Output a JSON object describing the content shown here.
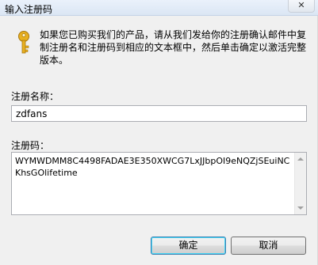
{
  "window": {
    "title": "输入注册码",
    "close_symbol": "✕"
  },
  "intro": {
    "icon": "key-icon",
    "text": "如果您已购买我们的产品，请从我们发给你的注册确认邮件中复制注册名和注册码到相应的文本框中，然后单击确定以激活完整版本。"
  },
  "name_field": {
    "label": "注册名称：",
    "value": "zdfans"
  },
  "code_field": {
    "label": "注册码：",
    "value": "WYMWDMM8C4498FADAE3E350XWCG7LxJJbpOI9eNQZjSEuiNCKhsGOlifetime"
  },
  "buttons": {
    "ok": "确定",
    "cancel": "取消"
  },
  "colors": {
    "key_gold": "#e8b020",
    "dialog_bg": "#f0f0f0"
  }
}
